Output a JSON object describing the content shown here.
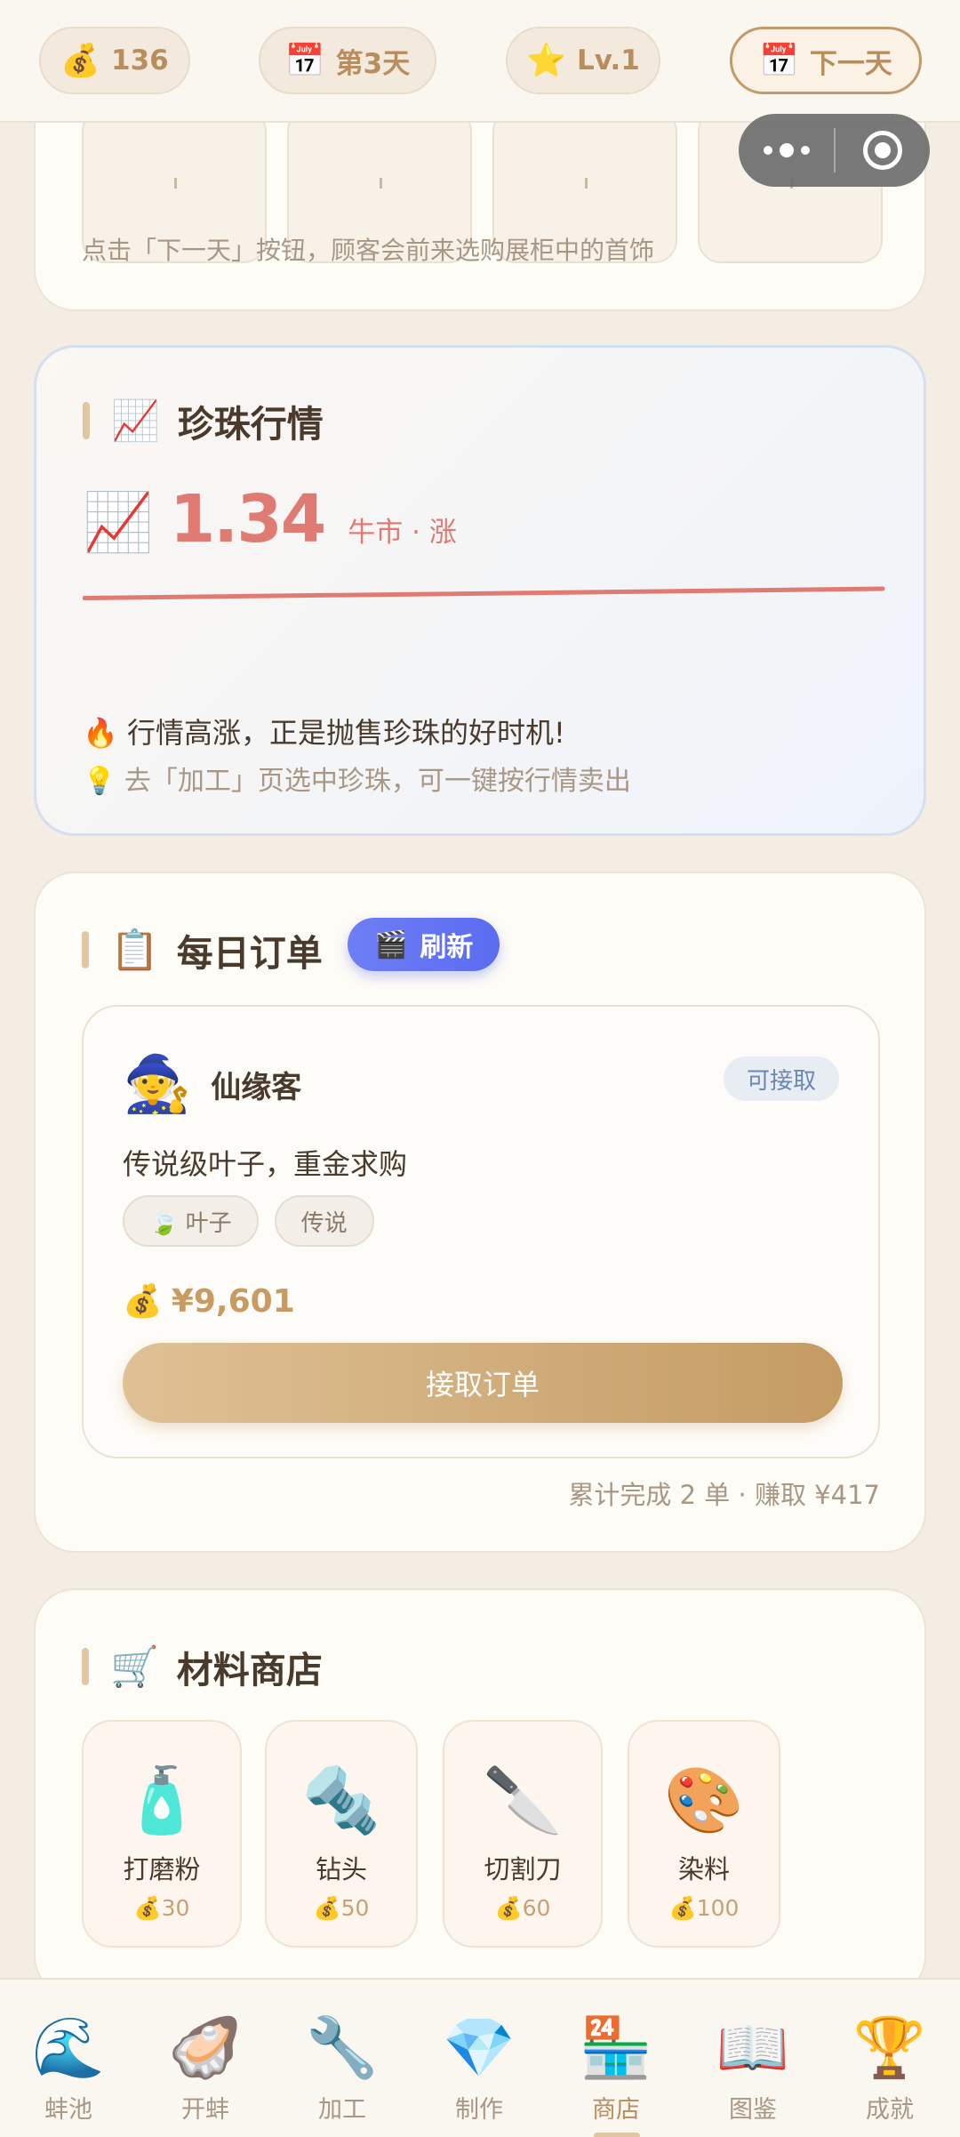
{
  "top_bar": {
    "coins": "136",
    "day": "第3天",
    "level": "Lv.1",
    "next_day": "下一天"
  },
  "showcase": {
    "hint": "点击「下一天」按钮，顾客会前来选购展柜中的首饰"
  },
  "market": {
    "title": "珍珠行情",
    "price": "1.34",
    "trend": "牛市 · 涨",
    "message": "🔥 行情高涨，正是抛售珍珠的好时机!",
    "tip": "💡 去「加工」页选中珍珠，可一键按行情卖出",
    "chart_data": {
      "type": "line",
      "title": "",
      "xlabel": "",
      "ylabel": "",
      "series": [
        {
          "values": [
            1.25,
            1.34
          ]
        }
      ]
    }
  },
  "orders": {
    "title": "每日订单",
    "refresh": "刷新",
    "customer": "仙缘客",
    "status": "可接取",
    "description": "传说级叶子，重金求购",
    "tags": [
      "🍃 叶子",
      "传说"
    ],
    "reward": "¥9,601",
    "accept": "接取订单",
    "stats": "累计完成 2 单 · 赚取 ¥417"
  },
  "shop": {
    "title": "材料商店",
    "items": [
      {
        "name": "打磨粉",
        "price": "30",
        "icon": "🧴"
      },
      {
        "name": "钻头",
        "price": "50",
        "icon": "🔩"
      },
      {
        "name": "切割刀",
        "price": "60",
        "icon": "🔪"
      },
      {
        "name": "染料",
        "price": "100",
        "icon": "🎨"
      }
    ]
  },
  "nav": [
    {
      "label": "蚌池",
      "icon": "🌊"
    },
    {
      "label": "开蚌",
      "icon": "🦪"
    },
    {
      "label": "加工",
      "icon": "🔧"
    },
    {
      "label": "制作",
      "icon": "💎"
    },
    {
      "label": "商店",
      "icon": "🏪"
    },
    {
      "label": "图鉴",
      "icon": "📖"
    },
    {
      "label": "成就",
      "icon": "🏆"
    }
  ],
  "colors": {
    "accent": "#c49b63",
    "market_red": "#e07b73",
    "refresh_blue": "#5b6cf0"
  }
}
